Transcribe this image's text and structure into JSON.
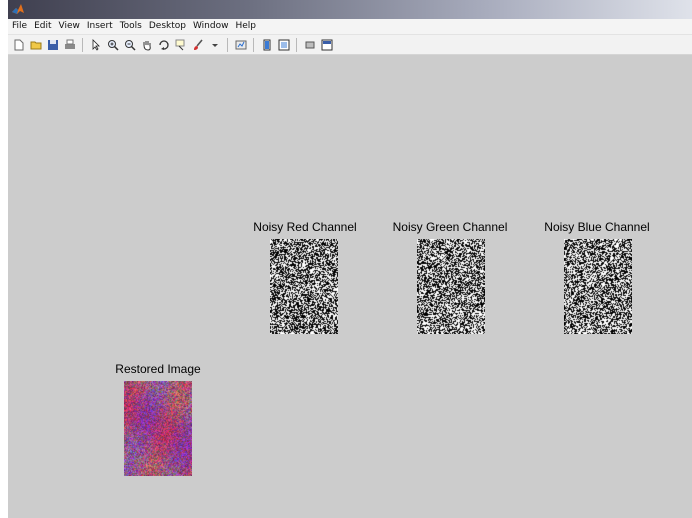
{
  "window": {
    "title": ""
  },
  "menu": {
    "items": [
      "File",
      "Edit",
      "View",
      "Insert",
      "Tools",
      "Desktop",
      "Window",
      "Help"
    ]
  },
  "toolbar": {
    "icons": [
      "new-file-icon",
      "open-folder-icon",
      "save-icon",
      "print-icon",
      "pointer-icon",
      "zoom-in-icon",
      "zoom-out-icon",
      "pan-hand-icon",
      "rotate-3d-icon",
      "data-cursor-icon",
      "brush-icon",
      "link-plot-icon",
      "colorbar-icon",
      "legend-icon",
      "hide-plot-tools-icon",
      "show-plot-tools-icon"
    ]
  },
  "figure": {
    "background": "#cccccc",
    "panels": [
      {
        "title": "Noisy Red Channel",
        "kind": "noise"
      },
      {
        "title": "Noisy Green Channel",
        "kind": "noise"
      },
      {
        "title": "Noisy Blue Channel",
        "kind": "noise"
      },
      {
        "title": "Restored Image",
        "kind": "color-noise"
      }
    ]
  }
}
